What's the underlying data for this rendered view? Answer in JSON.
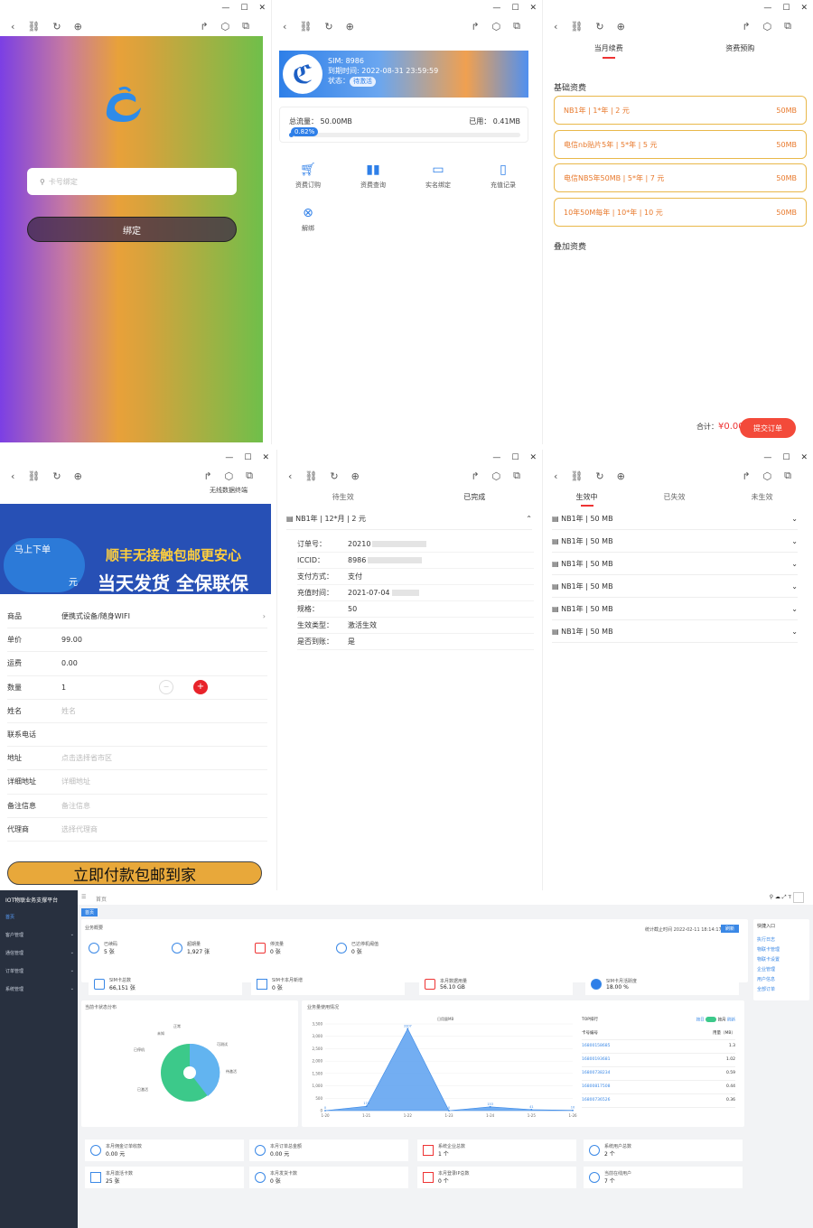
{
  "window_controls": {
    "min": "—",
    "max": "☐",
    "close": "✕"
  },
  "panel1": {
    "search_placeholder": "卡号绑定",
    "bind_button": "绑定"
  },
  "panel2": {
    "sim_label": "SIM: 8986",
    "expire": "到期时间: 2022-08-31 23:59:59",
    "status_label": "状态：",
    "status_badge": "待激活",
    "total_flow": "总流量： 50.00MB",
    "used": "已用： 0.41MB",
    "percent": "0.82%",
    "used_fraction": 0.0082,
    "grid": [
      {
        "icon": "cart-icon",
        "label": "资费订购"
      },
      {
        "icon": "bar-chart-icon",
        "label": "资费查询"
      },
      {
        "icon": "id-card-icon",
        "label": "实名绑定"
      },
      {
        "icon": "recharge-icon",
        "label": "充值记录"
      },
      {
        "icon": "unbind-icon",
        "label": "解绑"
      }
    ]
  },
  "panel3": {
    "tabs": [
      "当月续费",
      "资费预购"
    ],
    "section_basic": "基础资费",
    "plans": [
      {
        "name": "NB1年 | 1*年 | 2 元",
        "size": "50MB"
      },
      {
        "name": "电信nb贴片5年 | 5*年 | 5 元",
        "size": "50MB"
      },
      {
        "name": "电信NB5年50MB | 5*年 | 7 元",
        "size": "50MB"
      },
      {
        "name": "10年50M每年 | 10*年 | 10 元",
        "size": "50MB"
      }
    ],
    "section_extra": "叠加资费",
    "total_label": "合计：",
    "total_value": "¥0.00",
    "submit": "提交订单"
  },
  "panel4": {
    "banner_top": "无线数据终端",
    "banner_left": "马上下单",
    "banner_unit": "元",
    "banner_line1": "顺丰无接触包邮更安心",
    "banner_line2": "当天发货 全保联保",
    "fields": [
      {
        "k": "商品",
        "v": "便携式设备/随身WIFI"
      },
      {
        "k": "单价",
        "v": "99.00"
      },
      {
        "k": "运费",
        "v": "0.00"
      },
      {
        "k": "数量",
        "v": "1"
      },
      {
        "k": "姓名",
        "ph": "姓名"
      },
      {
        "k": "联系电话",
        "ph": ""
      },
      {
        "k": "地址",
        "ph": "点击选择省市区"
      },
      {
        "k": "详细地址",
        "ph": "详细地址"
      },
      {
        "k": "备注信息",
        "ph": "备注信息"
      },
      {
        "k": "代理商",
        "ph": "选择代理商"
      }
    ],
    "pay_button": "立即付款包邮到家",
    "minus": "−",
    "plus": "+"
  },
  "panel5": {
    "tabs": [
      "待生效",
      "已完成"
    ],
    "item": "NB1年 | 12*月 | 2 元",
    "rows": [
      {
        "k": "订单号：",
        "v": "20210"
      },
      {
        "k": "ICCID：",
        "v": "8986"
      },
      {
        "k": "支付方式：",
        "v": "支付"
      },
      {
        "k": "充值时间：",
        "v": "2021-07-04"
      },
      {
        "k": "规格：",
        "v": "50"
      },
      {
        "k": "生效类型：",
        "v": "激活生效"
      },
      {
        "k": "是否到账：",
        "v": "是"
      }
    ]
  },
  "panel6": {
    "tabs": [
      "生效中",
      "已失效",
      "未生效"
    ],
    "items": [
      "NB1年 | 50 MB",
      "NB1年 | 50 MB",
      "NB1年 | 50 MB",
      "NB1年 | 50 MB",
      "NB1年 | 50 MB",
      "NB1年 | 50 MB"
    ]
  },
  "panel7": {
    "brand": "IOT物联业务支撑平台",
    "menu": [
      "首页",
      "客户管理",
      "通信管理",
      "订单管理",
      "系统管理"
    ],
    "crumb": "首页",
    "tag": "首页",
    "section_title": "业务概要",
    "stat_time": "统计截止时间 2022-02-11 18:14:17",
    "refresh": "刷新",
    "stats1": [
      {
        "l": "已续码",
        "v": "5 张"
      },
      {
        "l": "超期量",
        "v": "1,927 张"
      },
      {
        "l": "停流量",
        "v": "0 张"
      },
      {
        "l": "已达停机阈值",
        "v": "0 张"
      }
    ],
    "stats2": [
      {
        "l": "SIM卡总数",
        "v": "66,151 张"
      },
      {
        "l": "SIM卡本月新增",
        "v": "0 张"
      },
      {
        "l": "本月数据用量",
        "v": "56.10 GB"
      },
      {
        "l": "SIM卡月活跃度",
        "v": "18.00 %"
      }
    ],
    "quick_title": "快捷入口",
    "quick": [
      "执行日志",
      "物联卡管理",
      "物联卡设置",
      "企业管理",
      "用户信息",
      "全部订单"
    ],
    "pie_title": "当前卡状态分布",
    "pie_labels": [
      "未知",
      "已停机",
      "正常",
      "可测试",
      "待激活",
      "已激活"
    ],
    "line_title": "业务量使用情况",
    "line_legend": "日用量MB",
    "top_title": "TOP排行",
    "top_switch": "按日",
    "top_switch2": "按月",
    "top_more": "刷新",
    "top_head": [
      "卡号编号",
      "用量（MB）"
    ],
    "top_rows": [
      [
        "16800158685",
        "1.3"
      ],
      [
        "16800193681",
        "1.02"
      ],
      [
        "16800738234",
        "0.59"
      ],
      [
        "16800817508",
        "0.44"
      ],
      [
        "16800736526",
        "0.36"
      ]
    ],
    "bottom": [
      {
        "l": "本月佣金订单收款",
        "v": "0.00 元"
      },
      {
        "l": "本月订单总金额",
        "v": "0.00 元"
      },
      {
        "l": "系统企业总数",
        "v": "1 个"
      },
      {
        "l": "系统用户总数",
        "v": "2 个"
      },
      {
        "l": "本月激活卡数",
        "v": "25 张"
      },
      {
        "l": "本月发货卡数",
        "v": "0 张"
      },
      {
        "l": "本月登录IP总数",
        "v": "0 个"
      },
      {
        "l": "当前在线用户",
        "v": "7 个"
      }
    ]
  },
  "chart_data": {
    "type": "area",
    "x": [
      "1-20",
      "1-21",
      "1-22",
      "1-23",
      "1-24",
      "1-25",
      "1-26"
    ],
    "values": [
      0,
      174,
      3307,
      0,
      153,
      41,
      10
    ],
    "ylim": [
      0,
      3500
    ],
    "series": [
      {
        "name": "日用量MB",
        "values": [
          0,
          174,
          3307,
          0,
          153,
          41,
          10
        ]
      }
    ]
  },
  "colors": {
    "accent": "#2e7fe8",
    "danger": "#f34a3a",
    "plan": "#e8792c"
  }
}
